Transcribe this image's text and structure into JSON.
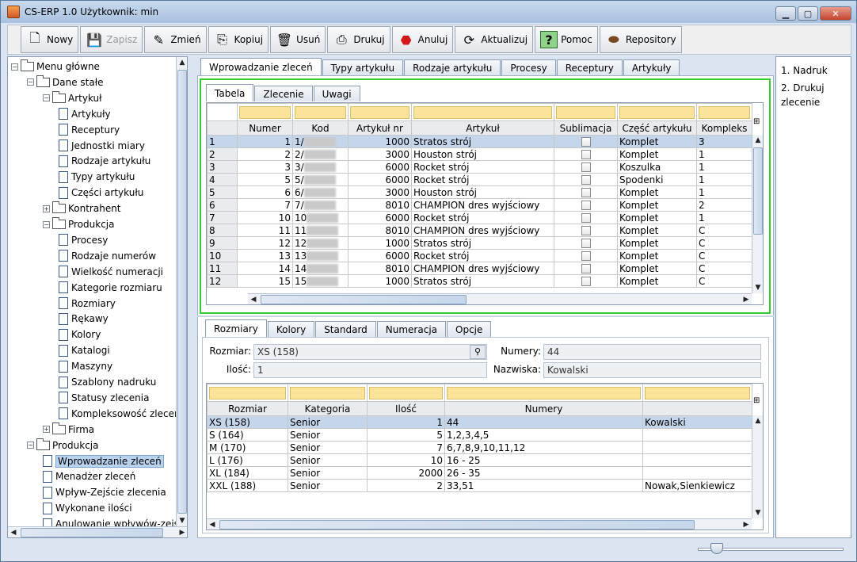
{
  "window": {
    "title": "CS-ERP 1.0  Użytkownik: min"
  },
  "toolbar": [
    {
      "label": "Nowy",
      "icon": "new-document-icon",
      "enabled": true
    },
    {
      "label": "Zapisz",
      "icon": "save-floppy-icon",
      "enabled": false
    },
    {
      "label": "Zmień",
      "icon": "edit-pencil-icon",
      "enabled": true
    },
    {
      "label": "Kopiuj",
      "icon": "copy-icon",
      "enabled": true
    },
    {
      "label": "Usuń",
      "icon": "trash-icon",
      "enabled": true
    },
    {
      "label": "Drukuj",
      "icon": "printer-icon",
      "enabled": true
    },
    {
      "label": "Anuluj",
      "icon": "stop-icon",
      "enabled": true
    },
    {
      "label": "Aktualizuj",
      "icon": "refresh-icon",
      "enabled": true
    },
    {
      "label": "Pomoc",
      "icon": "help-icon",
      "enabled": true
    },
    {
      "label": "Repository",
      "icon": "repository-icon",
      "enabled": true
    }
  ],
  "tree": [
    {
      "label": "Menu główne",
      "level": 0,
      "type": "folder",
      "exp": "-"
    },
    {
      "label": "Dane stałe",
      "level": 1,
      "type": "folder",
      "exp": "-"
    },
    {
      "label": "Artykuł",
      "level": 2,
      "type": "folder",
      "exp": "-"
    },
    {
      "label": "Artykuły",
      "level": 3,
      "type": "page"
    },
    {
      "label": "Receptury",
      "level": 3,
      "type": "page"
    },
    {
      "label": "Jednostki miary",
      "level": 3,
      "type": "page"
    },
    {
      "label": "Rodzaje artykułu",
      "level": 3,
      "type": "page"
    },
    {
      "label": "Typy artykułu",
      "level": 3,
      "type": "page"
    },
    {
      "label": "Części artykułu",
      "level": 3,
      "type": "page"
    },
    {
      "label": "Kontrahent",
      "level": 2,
      "type": "folder",
      "exp": "+"
    },
    {
      "label": "Produkcja",
      "level": 2,
      "type": "folder",
      "exp": "-"
    },
    {
      "label": "Procesy",
      "level": 3,
      "type": "page"
    },
    {
      "label": "Rodzaje numerów",
      "level": 3,
      "type": "page"
    },
    {
      "label": "Wielkość numeracji",
      "level": 3,
      "type": "page"
    },
    {
      "label": "Kategorie rozmiaru",
      "level": 3,
      "type": "page"
    },
    {
      "label": "Rozmiary",
      "level": 3,
      "type": "page"
    },
    {
      "label": "Rękawy",
      "level": 3,
      "type": "page"
    },
    {
      "label": "Kolory",
      "level": 3,
      "type": "page"
    },
    {
      "label": "Katalogi",
      "level": 3,
      "type": "page"
    },
    {
      "label": "Maszyny",
      "level": 3,
      "type": "page"
    },
    {
      "label": "Szablony nadruku",
      "level": 3,
      "type": "page"
    },
    {
      "label": "Statusy zlecenia",
      "level": 3,
      "type": "page"
    },
    {
      "label": "Kompleksowość zleceń",
      "level": 3,
      "type": "page"
    },
    {
      "label": "Firma",
      "level": 2,
      "type": "folder",
      "exp": "+"
    },
    {
      "label": "Produkcja",
      "level": 1,
      "type": "folder",
      "exp": "-"
    },
    {
      "label": "Wprowadzanie zleceń",
      "level": 2,
      "type": "page",
      "selected": true
    },
    {
      "label": "Menadżer zleceń",
      "level": 2,
      "type": "page"
    },
    {
      "label": "Wpływ-Zejście zlecenia",
      "level": 2,
      "type": "page"
    },
    {
      "label": "Wykonane ilości",
      "level": 2,
      "type": "page"
    },
    {
      "label": "Anulowanie wpływów-zejść",
      "level": 2,
      "type": "page"
    }
  ],
  "main_tabs": [
    "Wprowadzanie zleceń",
    "Typy artykułu",
    "Rodzaje artykułu",
    "Procesy",
    "Receptury",
    "Artykuły"
  ],
  "sub_tabs": [
    "Tabela",
    "Zlecenie",
    "Uwagi"
  ],
  "orders": {
    "columns": [
      "",
      "Numer",
      "Kod",
      "Artykuł nr",
      "Artykuł",
      "Sublimacja",
      "Część artykułu",
      "Kompleks"
    ],
    "rows": [
      [
        "1",
        "1",
        "1/",
        "1000",
        "Stratos strój",
        "",
        "Komplet",
        "3"
      ],
      [
        "2",
        "2",
        "2/",
        "3000",
        "Houston strój",
        "",
        "Komplet",
        "1"
      ],
      [
        "3",
        "3",
        "3/",
        "6000",
        "Rocket strój",
        "",
        "Koszulka",
        "1"
      ],
      [
        "4",
        "5",
        "5/",
        "6000",
        "Rocket strój",
        "",
        "Spodenki",
        "1"
      ],
      [
        "5",
        "6",
        "6/",
        "3000",
        "Houston strój",
        "",
        "Komplet",
        "1"
      ],
      [
        "6",
        "7",
        "7/",
        "8010",
        "CHAMPION dres wyjściowy",
        "",
        "Komplet",
        "2"
      ],
      [
        "7",
        "10",
        "10",
        "6000",
        "Rocket strój",
        "",
        "Komplet",
        "1"
      ],
      [
        "8",
        "11",
        "11",
        "8010",
        "CHAMPION dres wyjściowy",
        "",
        "Komplet",
        "C"
      ],
      [
        "9",
        "12",
        "12",
        "1000",
        "Stratos strój",
        "",
        "Komplet",
        "C"
      ],
      [
        "10",
        "13",
        "13",
        "6000",
        "Rocket strój",
        "",
        "Komplet",
        "C"
      ],
      [
        "11",
        "14",
        "14",
        "8010",
        "CHAMPION dres wyjściowy",
        "",
        "Komplet",
        "C"
      ],
      [
        "12",
        "15",
        "15",
        "1000",
        "Stratos strój",
        "",
        "Komplet",
        "C"
      ]
    ]
  },
  "bottom_tabs": [
    "Rozmiary",
    "Kolory",
    "Standard",
    "Numeracja",
    "Opcje"
  ],
  "form": {
    "rozmiar_label": "Rozmiar:",
    "rozmiar_value": "XS (158)",
    "ilosc_label": "Ilość:",
    "ilosc_value": "1",
    "numery_label": "Numery:",
    "numery_value": "44",
    "nazwiska_label": "Nazwiska:",
    "nazwiska_value": "Kowalski"
  },
  "sizes": {
    "columns": [
      "Rozmiar",
      "Kategoria",
      "Ilość",
      "Numery",
      ""
    ],
    "rows": [
      [
        "XS (158)",
        "Senior",
        "1",
        "44",
        "Kowalski"
      ],
      [
        "S (164)",
        "Senior",
        "5",
        "1,2,3,4,5",
        ""
      ],
      [
        "M (170)",
        "Senior",
        "7",
        "6,7,8,9,10,11,12",
        ""
      ],
      [
        "L (176)",
        "Senior",
        "10",
        "16 - 25",
        ""
      ],
      [
        "XL (184)",
        "Senior",
        "2000",
        "26 - 35",
        ""
      ],
      [
        "XXL (188)",
        "Senior",
        "2",
        "33,51",
        "Nowak,Sienkiewicz"
      ]
    ]
  },
  "right_panel": [
    "1. Nadruk",
    "2. Drukuj zlecenie"
  ],
  "colors": {
    "accent_green": "#33cc33",
    "filter_yellow": "#fbe39a",
    "selection": "#c4d6ec"
  }
}
